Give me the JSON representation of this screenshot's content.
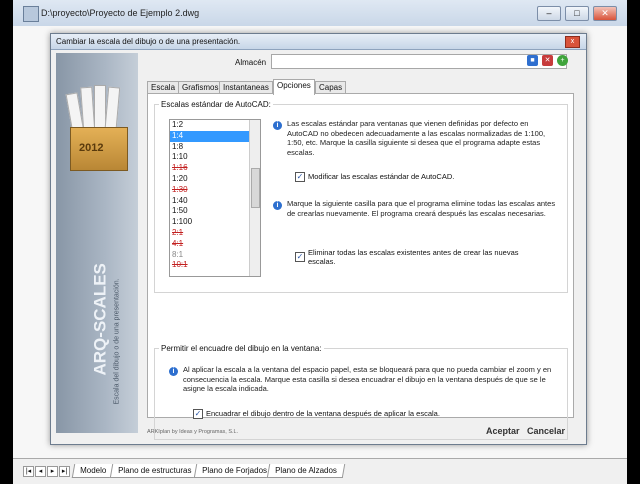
{
  "window": {
    "title": "D:\\proyecto\\Proyecto de Ejemplo 2.dwg",
    "minimize": "–",
    "maximize": "□",
    "close": "✕"
  },
  "dialog": {
    "title": "Cambiar la escala del dibujo o de una presentación.",
    "close": "x",
    "side": {
      "year": "2012",
      "product": "ARQ-SCALES",
      "subtitle": "Escala del dibujo o de una presentación."
    },
    "almacen": {
      "label": "Almacén",
      "value": ""
    },
    "tabs": [
      "Escala",
      "Grafismos",
      "Instantaneas",
      "Opciones",
      "Capas"
    ],
    "active_tab": "Opciones",
    "scales_group": {
      "title": "Escalas estándar de AutoCAD:",
      "items": [
        {
          "label": "1:2",
          "state": "normal"
        },
        {
          "label": "1:4",
          "state": "selected"
        },
        {
          "label": "1:8",
          "state": "normal"
        },
        {
          "label": "1:10",
          "state": "normal"
        },
        {
          "label": "1:16",
          "state": "strike"
        },
        {
          "label": "1:20",
          "state": "normal"
        },
        {
          "label": "1:30",
          "state": "strike"
        },
        {
          "label": "1:40",
          "state": "normal"
        },
        {
          "label": "1:50",
          "state": "normal"
        },
        {
          "label": "1:100",
          "state": "normal"
        },
        {
          "label": "2:1",
          "state": "strike"
        },
        {
          "label": "4:1",
          "state": "strike"
        },
        {
          "label": "8:1",
          "state": "gray"
        },
        {
          "label": "10:1",
          "state": "strike"
        }
      ],
      "info1": "Las escalas estándar para ventanas que vienen definidas por defecto en AutoCAD no obedecen adecuadamente a las escalas normalizadas de 1:100, 1:50, etc. Marque la casilla siguiente si desea que el programa adapte estas escalas.",
      "check1": "Modificar las escalas estándar de AutoCAD.",
      "check1_mark": "✓",
      "info2": "Marque la siguiente casilla para que el programa elimine todas las escalas antes de crearlas nuevamente. El programa creará después las escalas necesarias.",
      "check2": "Eliminar todas las escalas existentes antes de crear las nuevas escalas.",
      "check2_mark": "✓"
    },
    "fit_group": {
      "title": "Permitir el encuadre del dibujo en la ventana:",
      "info": "Al aplicar la escala a la ventana del espacio papel, esta se bloqueará para que no pueda cambiar el zoom y en consecuencia la escala. Marque esta casilla si desea encuadrar el dibujo en la ventana después de que se le asigne la escala indicada.",
      "check": "Encuadrar el dibujo dentro de la ventana después de aplicar la escala.",
      "check_mark": "✓"
    },
    "footer_brand": "ARKIplan by Ideas y Programas, S.L.",
    "accept": "Aceptar",
    "cancel": "Cancelar"
  },
  "layout_tabs": [
    "Modelo",
    "Plano de estructuras",
    "Plano de Forjados",
    "Plano de Alzados"
  ],
  "colors": {
    "accent": "#3399ff",
    "info": "#2d6fcf",
    "strike": "#c32020"
  }
}
